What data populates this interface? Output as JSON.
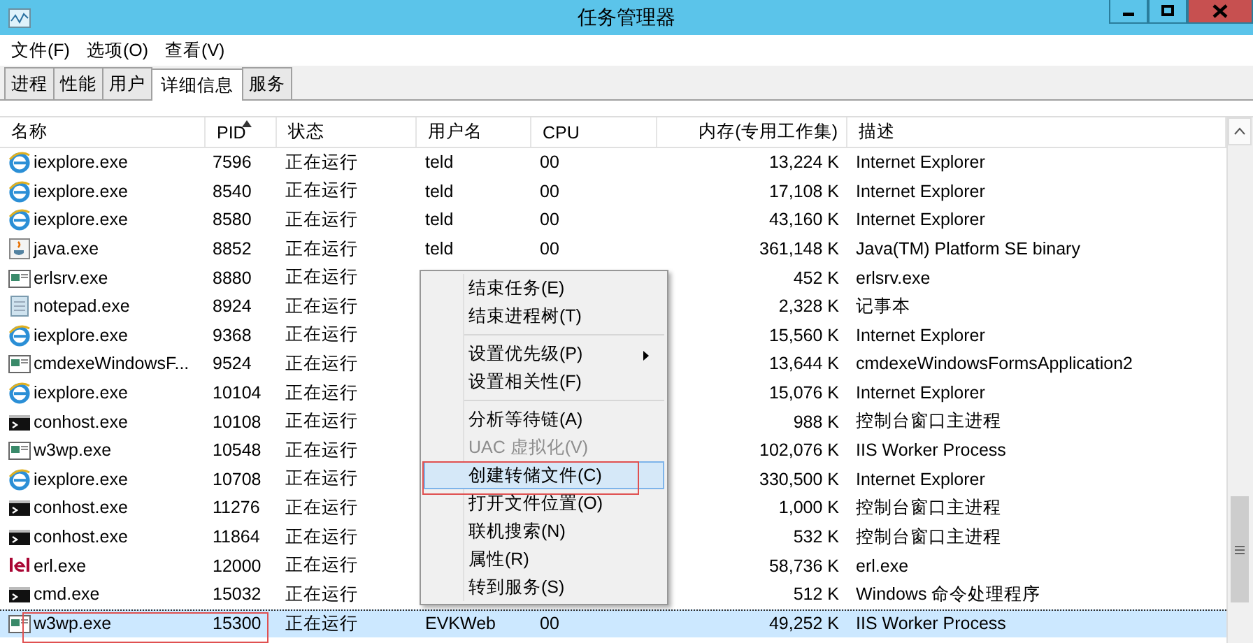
{
  "window": {
    "title": "任务管理器"
  },
  "menu_bar": [
    "文件(F)",
    "选项(O)",
    "查看(V)"
  ],
  "tabs": [
    {
      "label": "进程",
      "selected": false
    },
    {
      "label": "性能",
      "selected": false
    },
    {
      "label": "用户",
      "selected": false
    },
    {
      "label": "详细信息",
      "selected": true
    },
    {
      "label": "服务",
      "selected": false
    }
  ],
  "table": {
    "columns": [
      {
        "label": "名称",
        "sorted": false
      },
      {
        "label": "PID",
        "sorted": true
      },
      {
        "label": "状态",
        "sorted": false
      },
      {
        "label": "用户名",
        "sorted": false
      },
      {
        "label": "CPU",
        "sorted": false
      },
      {
        "label": "内存(专用工作集)",
        "sorted": false
      },
      {
        "label": "描述",
        "sorted": false
      }
    ],
    "rows": [
      {
        "kind": "ie",
        "name": "iexplore.exe",
        "pid": "7596",
        "status": "正在运行",
        "user": "teld",
        "cpu": "00",
        "memory": "13,224 K",
        "description": "Internet Explorer",
        "selected": false
      },
      {
        "kind": "ie",
        "name": "iexplore.exe",
        "pid": "8540",
        "status": "正在运行",
        "user": "teld",
        "cpu": "00",
        "memory": "17,108 K",
        "description": "Internet Explorer",
        "selected": false
      },
      {
        "kind": "ie",
        "name": "iexplore.exe",
        "pid": "8580",
        "status": "正在运行",
        "user": "teld",
        "cpu": "00",
        "memory": "43,160 K",
        "description": "Internet Explorer",
        "selected": false
      },
      {
        "kind": "java",
        "name": "java.exe",
        "pid": "8852",
        "status": "正在运行",
        "user": "teld",
        "cpu": "00",
        "memory": "361,148 K",
        "description": "Java(TM) Platform SE binary",
        "selected": false
      },
      {
        "kind": "app",
        "name": "erlsrv.exe",
        "pid": "8880",
        "status": "正在运行",
        "memory": "452 K",
        "description": "erlsrv.exe",
        "selected": false
      },
      {
        "kind": "notepad",
        "name": "notepad.exe",
        "pid": "8924",
        "status": "正在运行",
        "memory": "2,328 K",
        "description": "记事本",
        "selected": false
      },
      {
        "kind": "ie",
        "name": "iexplore.exe",
        "pid": "9368",
        "status": "正在运行",
        "memory": "15,560 K",
        "description": "Internet Explorer",
        "selected": false
      },
      {
        "kind": "app",
        "name": "cmdexeWindowsF...",
        "pid": "9524",
        "status": "正在运行",
        "memory": "13,644 K",
        "description": "cmdexeWindowsFormsApplication2",
        "selected": false
      },
      {
        "kind": "ie",
        "name": "iexplore.exe",
        "pid": "10104",
        "status": "正在运行",
        "memory": "15,076 K",
        "description": "Internet Explorer",
        "selected": false
      },
      {
        "kind": "console",
        "name": "conhost.exe",
        "pid": "10108",
        "status": "正在运行",
        "memory": "988 K",
        "description": "控制台窗口主进程",
        "selected": false
      },
      {
        "kind": "app",
        "name": "w3wp.exe",
        "pid": "10548",
        "status": "正在运行",
        "memory": "102,076 K",
        "description": "IIS Worker Process",
        "selected": false
      },
      {
        "kind": "ie",
        "name": "iexplore.exe",
        "pid": "10708",
        "status": "正在运行",
        "memory": "330,500 K",
        "description": "Internet Explorer",
        "selected": false
      },
      {
        "kind": "console",
        "name": "conhost.exe",
        "pid": "11276",
        "status": "正在运行",
        "memory": "1,000 K",
        "description": "控制台窗口主进程",
        "selected": false
      },
      {
        "kind": "console",
        "name": "conhost.exe",
        "pid": "11864",
        "status": "正在运行",
        "memory": "532 K",
        "description": "控制台窗口主进程",
        "selected": false
      },
      {
        "kind": "erl",
        "name": "erl.exe",
        "pid": "12000",
        "status": "正在运行",
        "memory": "58,736 K",
        "description": "erl.exe",
        "selected": false
      },
      {
        "kind": "console",
        "name": "cmd.exe",
        "pid": "15032",
        "status": "正在运行",
        "memory": "512 K",
        "description": "Windows 命令处理程序",
        "selected": false
      },
      {
        "kind": "app",
        "name": "w3wp.exe",
        "pid": "15300",
        "status": "正在运行",
        "user": "EVKWeb",
        "cpu": "00",
        "memory": "49,252 K",
        "description": "IIS Worker Process",
        "selected": true,
        "annotated": true
      }
    ]
  },
  "context_menu": {
    "items": [
      {
        "kind": "item",
        "label": "结束任务(E)",
        "disabled": false,
        "selected": false
      },
      {
        "kind": "item",
        "label": "结束进程树(T)",
        "disabled": false,
        "selected": false
      },
      {
        "kind": "separator"
      },
      {
        "kind": "item",
        "label": "设置优先级(P)",
        "disabled": false,
        "submenu": true,
        "selected": false
      },
      {
        "kind": "item",
        "label": "设置相关性(F)",
        "disabled": false,
        "selected": false
      },
      {
        "kind": "separator"
      },
      {
        "kind": "item",
        "label": "分析等待链(A)",
        "disabled": false,
        "selected": false
      },
      {
        "kind": "item",
        "label": "UAC 虚拟化(V)",
        "disabled": true,
        "selected": false
      },
      {
        "kind": "item",
        "label": "创建转储文件(C)",
        "disabled": false,
        "selected": true,
        "annotated": true
      },
      {
        "kind": "item",
        "label": "打开文件位置(O)",
        "disabled": false,
        "selected": false
      },
      {
        "kind": "item",
        "label": "联机搜索(N)",
        "disabled": false,
        "selected": false
      },
      {
        "kind": "item",
        "label": "属性(R)",
        "disabled": false,
        "selected": false
      },
      {
        "kind": "item",
        "label": "转到服务(S)",
        "disabled": false,
        "selected": false
      }
    ]
  }
}
